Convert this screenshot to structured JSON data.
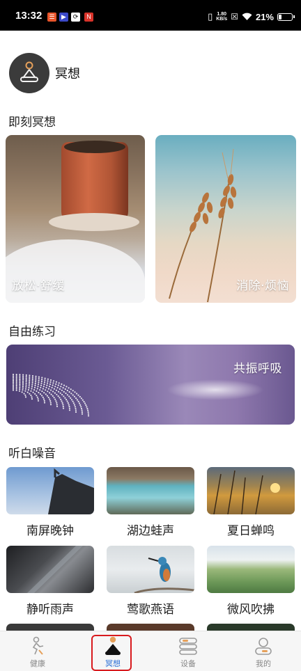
{
  "status_bar": {
    "time": "13:32",
    "network_speed_value": "1.80",
    "network_speed_unit": "KB/s",
    "battery_percent": "21%",
    "battery_level": 0.21
  },
  "header": {
    "title": "冥想"
  },
  "sections": {
    "instant": "即刻冥想",
    "free_practice": "自由练习",
    "white_noise": "听白噪音"
  },
  "instant_cards": [
    {
      "label": "放松·舒缓"
    },
    {
      "label": "消除·烦恼"
    }
  ],
  "practice_card": {
    "label": "共振呼吸"
  },
  "noise_items": [
    {
      "label": "南屏晚钟"
    },
    {
      "label": "湖边蛙声"
    },
    {
      "label": "夏日蝉鸣"
    },
    {
      "label": "静听雨声"
    },
    {
      "label": "莺歌燕语"
    },
    {
      "label": "微风吹拂"
    }
  ],
  "bottom_nav": [
    {
      "label": "健康"
    },
    {
      "label": "冥想"
    },
    {
      "label": "设备"
    },
    {
      "label": "我的"
    }
  ],
  "colors": {
    "accent_blue": "#2a6fd6",
    "highlight_red": "#d8191d",
    "nav_inactive": "#888888"
  }
}
